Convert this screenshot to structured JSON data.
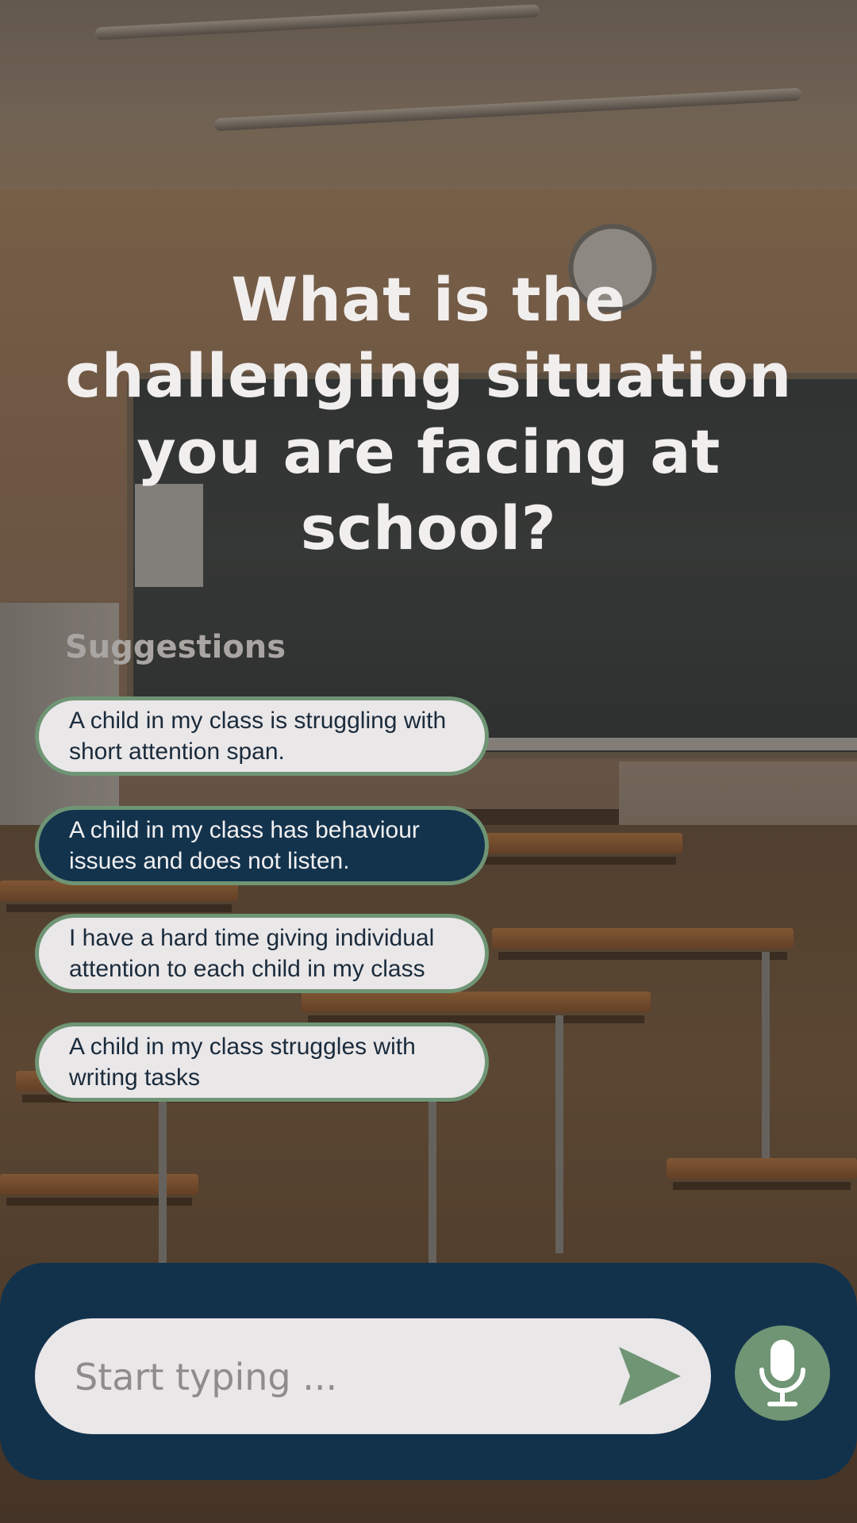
{
  "question": {
    "title": "What is the challenging situation you are facing at school?"
  },
  "suggestions": {
    "heading": "Suggestions",
    "items": [
      {
        "text": "A child in my class is struggling with short attention span.",
        "selected": false
      },
      {
        "text": "A child in my class has behaviour issues and does not listen.",
        "selected": true
      },
      {
        "text": "I have a hard time giving individual attention to each child in my class",
        "selected": false
      },
      {
        "text": "A child in my class struggles with writing tasks",
        "selected": false
      }
    ]
  },
  "composer": {
    "placeholder": "Start typing ...",
    "send_icon": "send-icon",
    "mic_icon": "microphone-icon"
  },
  "colors": {
    "navy": "#12324c",
    "chip_border": "#6f9575",
    "chip_bg": "#eae7e9",
    "mic_bg": "#6f9575"
  }
}
